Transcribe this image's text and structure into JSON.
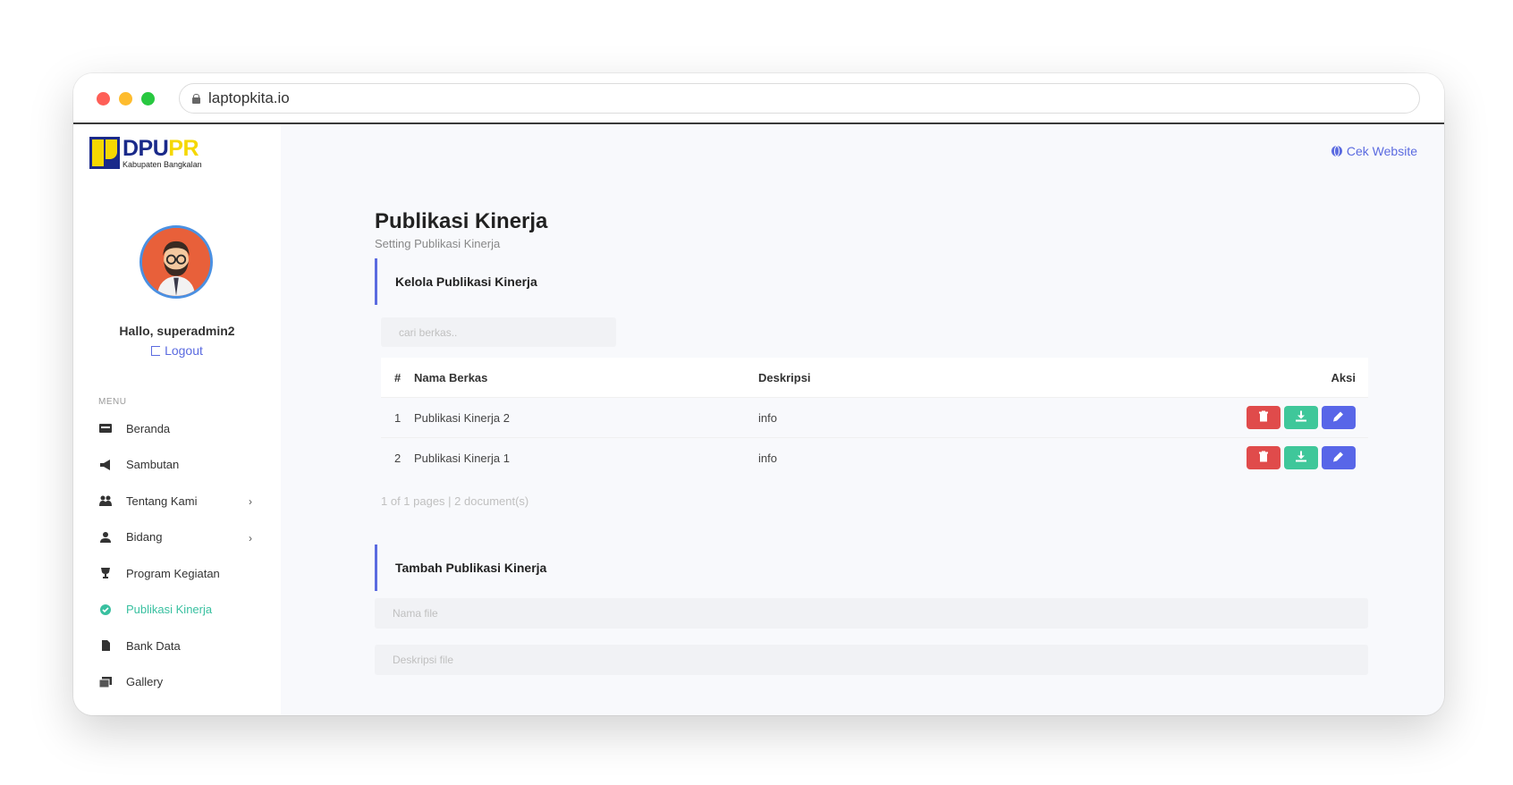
{
  "browser": {
    "url": "laptopkita.io"
  },
  "sidebar": {
    "logo": {
      "title_part1": "DPU",
      "title_part2": "PR",
      "subtitle": "Kabupaten Bangkalan"
    },
    "greeting": "Hallo, superadmin2",
    "logout_label": "Logout",
    "menu_label": "MENU",
    "items": [
      {
        "label": "Beranda",
        "icon": "card-icon",
        "has_submenu": false,
        "active": false
      },
      {
        "label": "Sambutan",
        "icon": "megaphone-icon",
        "has_submenu": false,
        "active": false
      },
      {
        "label": "Tentang Kami",
        "icon": "people-icon",
        "has_submenu": true,
        "active": false
      },
      {
        "label": "Bidang",
        "icon": "person-icon",
        "has_submenu": true,
        "active": false
      },
      {
        "label": "Program Kegiatan",
        "icon": "trophy-icon",
        "has_submenu": false,
        "active": false
      },
      {
        "label": "Publikasi Kinerja",
        "icon": "check-badge-icon",
        "has_submenu": false,
        "active": true
      },
      {
        "label": "Bank Data",
        "icon": "file-icon",
        "has_submenu": false,
        "active": false
      },
      {
        "label": "Gallery",
        "icon": "images-icon",
        "has_submenu": false,
        "active": false
      }
    ]
  },
  "header": {
    "cek_website_label": "Cek Website"
  },
  "page": {
    "title": "Publikasi Kinerja",
    "subtitle": "Setting Publikasi Kinerja"
  },
  "manage_section": {
    "heading": "Kelola Publikasi Kinerja",
    "search_placeholder": "cari berkas..",
    "table": {
      "headers": [
        "#",
        "Nama Berkas",
        "Deskripsi",
        "Aksi"
      ],
      "rows": [
        {
          "no": "1",
          "name": "Publikasi Kinerja 2",
          "description": "info"
        },
        {
          "no": "2",
          "name": "Publikasi Kinerja 1",
          "description": "info"
        }
      ]
    },
    "pagination": "1 of 1 pages | 2 document(s)"
  },
  "add_section": {
    "heading": "Tambah Publikasi Kinerja",
    "name_placeholder": "Nama file",
    "desc_placeholder": "Deskripsi file"
  },
  "colors": {
    "accent": "#5b6be0",
    "active_menu": "#39c0a0",
    "delete": "#e04b4b",
    "download": "#3fc79a",
    "edit": "#5866e8"
  }
}
